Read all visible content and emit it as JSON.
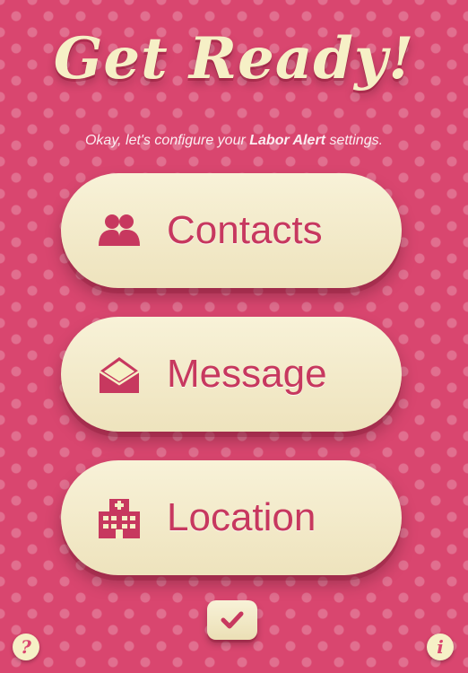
{
  "header": {
    "title": "Get Ready!",
    "subtitle_prefix": "Okay, let's configure your ",
    "subtitle_bold": "Labor Alert",
    "subtitle_suffix": " settings."
  },
  "menu": [
    {
      "label": "Contacts",
      "icon": "people-icon"
    },
    {
      "label": "Message",
      "icon": "envelope-icon"
    },
    {
      "label": "Location",
      "icon": "hospital-icon"
    }
  ],
  "footer": {
    "done_icon": "checkmark-icon",
    "help_label": "?",
    "info_label": "i"
  },
  "colors": {
    "background": "#d9466f",
    "button": "#f6f0c6",
    "accent": "#c7385f"
  }
}
